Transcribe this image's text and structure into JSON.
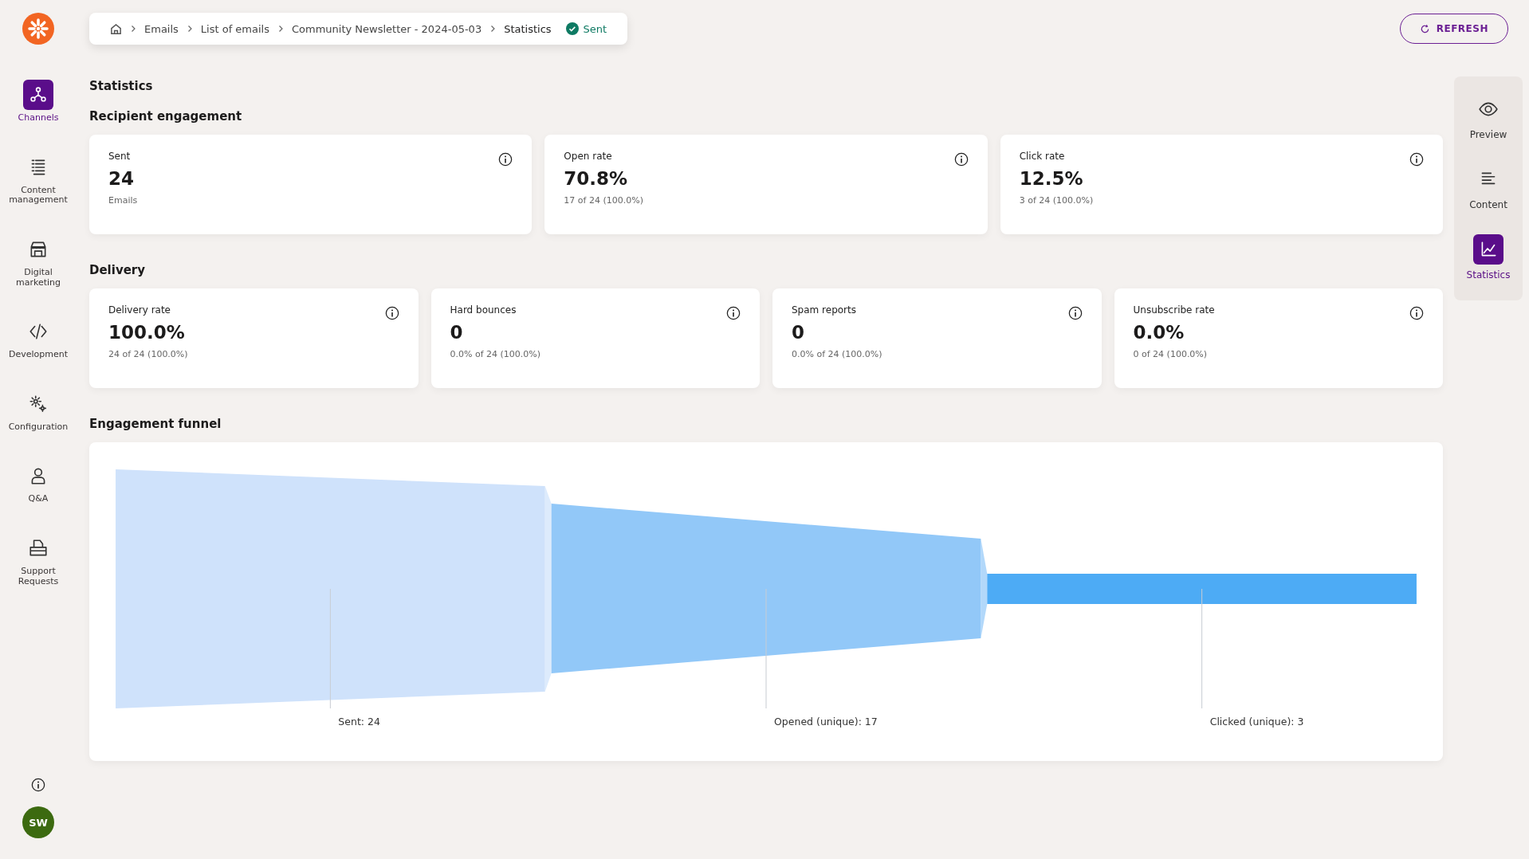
{
  "sidebar": {
    "items": [
      {
        "label": "Channels",
        "selected": true
      },
      {
        "label": "Content management",
        "selected": false
      },
      {
        "label": "Digital marketing",
        "selected": false
      },
      {
        "label": "Development",
        "selected": false
      },
      {
        "label": "Configuration",
        "selected": false
      },
      {
        "label": "Q&A",
        "selected": false
      },
      {
        "label": "Support Requests",
        "selected": false
      }
    ],
    "avatar": "SW"
  },
  "breadcrumb": {
    "items": [
      "Emails",
      "List of emails",
      "Community Newsletter - 2024-05-03",
      "Statistics"
    ],
    "status": "Sent"
  },
  "refresh_button": "REFRESH",
  "page_title": "Statistics",
  "sections": [
    {
      "title": "Recipient engagement",
      "cards": [
        {
          "label": "Sent",
          "value": "24",
          "detail": "Emails"
        },
        {
          "label": "Open rate",
          "value": "70.8%",
          "detail": "17 of 24 (100.0%)"
        },
        {
          "label": "Click rate",
          "value": "12.5%",
          "detail": "3 of 24 (100.0%)"
        }
      ]
    },
    {
      "title": "Delivery",
      "cards": [
        {
          "label": "Delivery rate",
          "value": "100.0%",
          "detail": "24 of 24 (100.0%)"
        },
        {
          "label": "Hard bounces",
          "value": "0",
          "detail": "0.0% of 24 (100.0%)"
        },
        {
          "label": "Spam reports",
          "value": "0",
          "detail": "0.0% of 24 (100.0%)"
        },
        {
          "label": "Unsubscribe rate",
          "value": "0.0%",
          "detail": "0 of 24 (100.0%)"
        }
      ]
    }
  ],
  "funnel": {
    "title": "Engagement funnel",
    "stages": [
      {
        "label": "Sent: 24"
      },
      {
        "label": "Opened (unique): 17"
      },
      {
        "label": "Clicked (unique): 3"
      }
    ]
  },
  "right_panel": {
    "items": [
      {
        "label": "Preview",
        "selected": false
      },
      {
        "label": "Content",
        "selected": false
      },
      {
        "label": "Statistics",
        "selected": true
      }
    ]
  }
}
